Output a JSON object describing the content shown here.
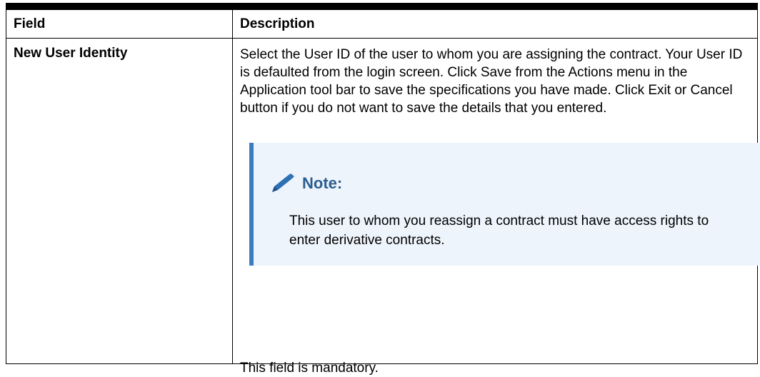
{
  "table": {
    "headers": {
      "field": "Field",
      "description": "Description"
    },
    "rows": [
      {
        "field": "New User Identity",
        "description": "Select the User ID of the user to whom you are assigning the contract. Your User ID is defaulted from the login screen. Click Save from the Actions menu in the Application tool bar to save the specifications you have made. Click Exit or Cancel button if you do not want to save the details that you entered.",
        "note": {
          "icon": "pencil-icon",
          "title": "Note:",
          "text": "This user to whom you reassign a contract must have access rights to enter derivative contracts."
        },
        "footer_text": "This field is mandatory."
      }
    ]
  },
  "colors": {
    "note_background": "#eef4fb",
    "note_accent": "#3d7bbf",
    "note_title": "#2c5f8f"
  }
}
